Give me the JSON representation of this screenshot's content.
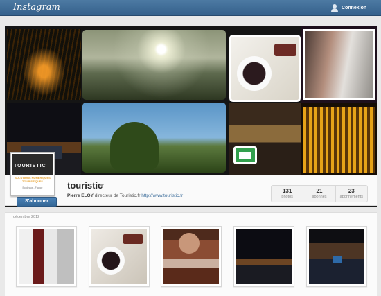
{
  "topbar": {
    "logo": "Instagram",
    "login_label": "Connexion"
  },
  "profile": {
    "username": "touristic",
    "avatar_brand": "TOURISTIC",
    "avatar_tagline": "SOLUTIONS NUMÉRIQUES TOURISTIQUES",
    "avatar_location": "Bordeaux - France",
    "follow_label": "S'abonner",
    "bio_name": "Pierre ELOY",
    "bio_text": "directeur de Touristic.fr",
    "bio_link": "http://www.touristic.fr",
    "stats": [
      {
        "count": "131",
        "label": "photos"
      },
      {
        "count": "21",
        "label": "abonnés"
      },
      {
        "count": "23",
        "label": "abonnements"
      }
    ]
  },
  "feed": {
    "date_label": "décembre 2012"
  }
}
